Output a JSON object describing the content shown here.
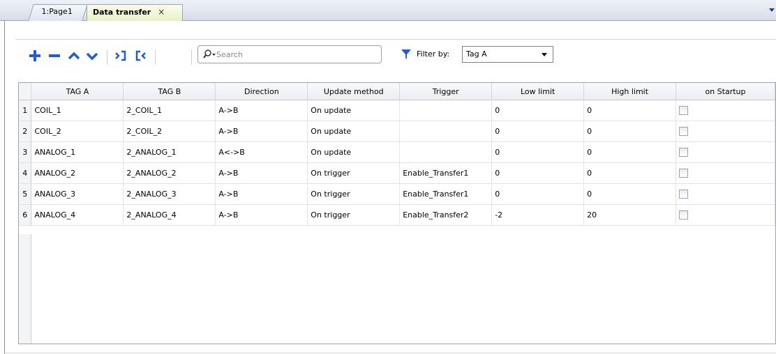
{
  "tabs": [
    {
      "label": "1:Page1"
    },
    {
      "label": "Data transfer",
      "close": "×"
    }
  ],
  "toolbar": {
    "buttons": [
      {
        "name": "add-icon"
      },
      {
        "name": "remove-icon"
      },
      {
        "name": "move-up-icon"
      },
      {
        "name": "move-down-icon"
      },
      {
        "name": "expand-icon"
      },
      {
        "name": "collapse-icon"
      }
    ],
    "search_placeholder": "Search",
    "filter_label": "Filter by:",
    "filter_value": "Tag A",
    "colors": {
      "accent": "#1f5bd6"
    }
  },
  "table": {
    "columns": [
      "TAG A",
      "TAG B",
      "Direction",
      "Update method",
      "Trigger",
      "Low limit",
      "High limit",
      "on Startup"
    ],
    "rows": [
      {
        "num": "1",
        "tag_a": "COIL_1",
        "tag_b": "2_COIL_1",
        "direction": "A->B",
        "update": "On update",
        "trigger": "",
        "low": "0",
        "high": "0",
        "startup": false
      },
      {
        "num": "2",
        "tag_a": "COIL_2",
        "tag_b": "2_COIL_2",
        "direction": "A->B",
        "update": "On update",
        "trigger": "",
        "low": "0",
        "high": "0",
        "startup": false
      },
      {
        "num": "3",
        "tag_a": "ANALOG_1",
        "tag_b": "2_ANALOG_1",
        "direction": "A<->B",
        "update": "On update",
        "trigger": "",
        "low": "0",
        "high": "0",
        "startup": false
      },
      {
        "num": "4",
        "tag_a": "ANALOG_2",
        "tag_b": "2_ANALOG_2",
        "direction": "A->B",
        "update": "On trigger",
        "trigger": "Enable_Transfer1",
        "low": "0",
        "high": "0",
        "startup": false
      },
      {
        "num": "5",
        "tag_a": "ANALOG_3",
        "tag_b": "2_ANALOG_3",
        "direction": "A->B",
        "update": "On trigger",
        "trigger": "Enable_Transfer1",
        "low": "0",
        "high": "0",
        "startup": false
      },
      {
        "num": "6",
        "tag_a": "ANALOG_4",
        "tag_b": "2_ANALOG_4",
        "direction": "A->B",
        "update": "On trigger",
        "trigger": "Enable_Transfer2",
        "low": "-2",
        "high": "20",
        "startup": false
      }
    ]
  }
}
